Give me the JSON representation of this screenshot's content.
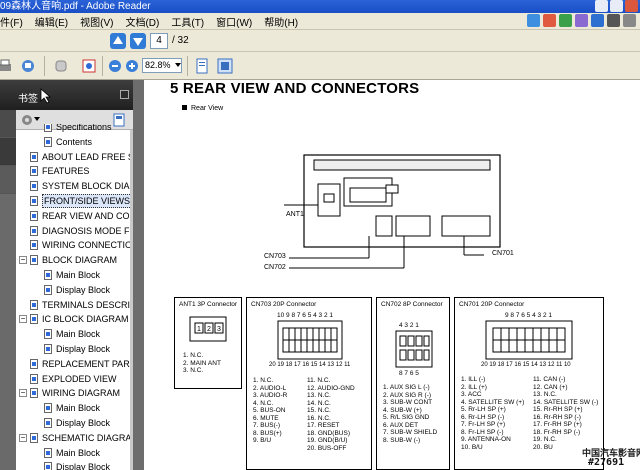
{
  "window": {
    "title": "09森林人音响.pdf - Adobe Reader"
  },
  "menu": [
    "编辑(E)",
    "视图(V)",
    "文档(D)",
    "工具(T)",
    "窗口(W)",
    "帮助(H)"
  ],
  "menu_first_partial": "件(F)",
  "toolbar": {
    "page_current": "4",
    "page_total": "/ 32",
    "zoom": "82.8%"
  },
  "sidebar": {
    "label": "书签",
    "bookmarks": [
      {
        "label": "Specifications",
        "level": 2
      },
      {
        "label": "Contents",
        "level": 2
      },
      {
        "label": "ABOUT LEAD FREE S",
        "level": 1
      },
      {
        "label": "FEATURES",
        "level": 1
      },
      {
        "label": "SYSTEM BLOCK DIAG",
        "level": 1
      },
      {
        "label": "FRONT/SIDE VIEWS",
        "level": 1,
        "selected": true
      },
      {
        "label": "REAR VIEW AND CO",
        "level": 1
      },
      {
        "label": "DIAGNOSIS MODE F",
        "level": 1
      },
      {
        "label": "WIRING CONNECTIO",
        "level": 1
      },
      {
        "label": "BLOCK DIAGRAM",
        "level": 1,
        "expandable": true
      },
      {
        "label": "Main Block",
        "level": 2
      },
      {
        "label": "Display Block",
        "level": 2
      },
      {
        "label": "TERMINALS DESCRI",
        "level": 1
      },
      {
        "label": "IC BLOCK DIAGRAM",
        "level": 1,
        "expandable": true
      },
      {
        "label": "Main Block",
        "level": 2
      },
      {
        "label": "Display Block",
        "level": 2
      },
      {
        "label": "REPLACEMENT PAR",
        "level": 1
      },
      {
        "label": "EXPLODED VIEW",
        "level": 1
      },
      {
        "label": "WIRING DIAGRAM",
        "level": 1,
        "expandable": true
      },
      {
        "label": "Main Block",
        "level": 2
      },
      {
        "label": "Display Block",
        "level": 2
      },
      {
        "label": "SCHEMATIC DIAGRA",
        "level": 1,
        "expandable": true
      },
      {
        "label": "Main Block",
        "level": 2
      },
      {
        "label": "Display Block",
        "level": 2
      }
    ]
  },
  "document": {
    "heading": "5   REAR VIEW AND CONNECTORS",
    "subheading": "Rear View",
    "labels": {
      "ant1": "ANT1",
      "cn703": "CN703",
      "cn702": "CN702",
      "cn701": "CN701"
    },
    "boxes": {
      "ant1": {
        "title": "ANT1 3P Connector",
        "pins": [
          "1.  N.C.",
          "2.  MAIN ANT",
          "3.  N.C."
        ]
      },
      "cn703": {
        "title": "CN703 20P Connector",
        "top_numbers": "10 9 8 7 6  5 4 3 2 1",
        "bottom_numbers": "20 19 18 17 16 15 14 13 12 11",
        "pins_left": [
          "1.  N.C.",
          "2.  AUDIO-L",
          "3.  AUDIO-R",
          "4.  N.C.",
          "5.  BUS-ON",
          "6.  MUTE",
          "7.  BUS(-)",
          "8.  BUS(+)",
          "9.  B/U"
        ],
        "pins_right": [
          "11.  N.C.",
          "12.  AUDIO-GND",
          "13.  N.C.",
          "14.  N.C.",
          "15.  N.C.",
          "16.  N.C.",
          "17.  RESET",
          "18.  GND(BUS)",
          "19.  GND(B/U)",
          "20.  BUS-OFF"
        ]
      },
      "cn702": {
        "title": "CN702 8P Connector",
        "top_numbers": "4  3  2  1",
        "bottom_numbers": "8  7  6  5",
        "pins": [
          "1.  AUX SIG L (-)",
          "2.  AUX SIG R (-)",
          "3.  SUB-W CONT",
          "4.  SUB-W (+)",
          "5.  R/L SIG GND",
          "6.  AUX DET",
          "7.  SUB-W SHIELD",
          "8.  SUB-W (-)"
        ]
      },
      "cn701": {
        "title": "CN701 20P Connector",
        "top_numbers": "9 8 7 6 5 4 3 2 1",
        "bottom_numbers": "20 19 18 17 16 15 14 13 12 11 10",
        "pins_left": [
          "1.  ILL (-)",
          "2.  ILL (+)",
          "3.  ACC",
          "4.  SATELLITE SW (+)",
          "5.  Rr-LH SP (+)",
          "6.  Rr-LH SP (-)",
          "7.  Fr-LH SP (+)",
          "8.  Fr-LH SP (-)",
          "9.  ANTENNA-ON",
          "10.  B/U"
        ],
        "pins_right": [
          "11.  CAN (-)",
          "12.  CAN (+)",
          "13.  N.C.",
          "14.  SATELLITE SW (-)",
          "15.  Rr-RH SP (+)",
          "16.  Rr-RH SP (-)",
          "17.  Fr-RH SP (+)",
          "18.  Fr-RH SP (-)",
          "19.  N.C.",
          "20.  BU"
        ]
      }
    }
  },
  "watermark": {
    "line1": "中国汽车影音网",
    "line2": "#27691"
  }
}
